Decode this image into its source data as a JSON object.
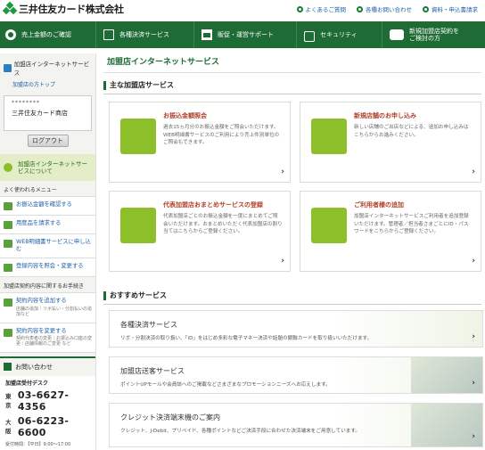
{
  "header": {
    "logo_text": "三井住友カード株式会社",
    "links": [
      "よくあるご質問",
      "各種お問い合わせ",
      "資料・申込書請求"
    ]
  },
  "nav": {
    "items": [
      "売上金額のご確認",
      "各種決済サービス",
      "販促・運営サポート",
      "セキュリティ",
      "新規加盟店契約を\nご検討の方"
    ]
  },
  "sidebar": {
    "title": "加盟店インターネットサービス",
    "sub_link": "加盟店の方トップ",
    "user_id": "********",
    "user_name": "三井住友カード商店",
    "logout_label": "ログアウト",
    "promo_text": "加盟店インターネットサービスについて",
    "menu_heading": "よく使われるメニュー",
    "menu_items": [
      {
        "label": "お振込金額を確認する",
        "note": ""
      },
      {
        "label": "用度品を請求する",
        "note": ""
      },
      {
        "label": "WEB明細書サービスに申し込む",
        "note": ""
      },
      {
        "label": "登録内容を照会・変更する",
        "note": ""
      }
    ],
    "contract_heading": "加盟店契約内容に関するお手続き",
    "contract_items": [
      {
        "label": "契約内容を追加する",
        "note": "店舗の追加｜リボ払い・分割払いの追加など"
      },
      {
        "label": "契約内容を変更する",
        "note": "契約代表者の変更｜お振込み口座の変更｜店舗情報のご変更 など"
      }
    ],
    "contact": {
      "heading": "お問い合わせ",
      "desk": "加盟店受付デスク",
      "tokyo_label": "東京",
      "tokyo_number": "03-6627-4356",
      "osaka_label": "大阪",
      "osaka_number": "06-6223-6600",
      "hours": "受付時間：【平日】9:00〜17:00"
    }
  },
  "main": {
    "page_title": "加盟店インターネットサービス",
    "section_main": "主な加盟店サービス",
    "cards": [
      {
        "title": "お振込金額照会",
        "desc": "過去15ヵ月分のお振込金額をご照会いただけます。WEB明細書サービスのご利用により売上件別単位のご照会もできます。"
      },
      {
        "title": "新規店舗のお申し込み",
        "desc": "新しい店舗のご出店などによる、追加お申し込みはこちらからお進みください。"
      },
      {
        "title": "代表加盟店おまとめサービスの登録",
        "desc": "代表加盟店ごとのお振込金額を一度にまとめてご照会いただけます。おまとめいただく代表加盟店の割り当てはこちらからご登録ください。"
      },
      {
        "title": "ご利用者様の追加",
        "desc": "加盟店インターネットサービスご利用者を追加登録いただけます。管理者／担当者さまごとにID・パスワードをこちらからご登録ください。"
      }
    ],
    "section_rec": "おすすめサービス",
    "recs": [
      {
        "title": "各種決済サービス",
        "desc": "リボ・分割決済の取り扱い、「iD」をはじめ多彩な電子マネー決済や話題の銀聯カードを取り扱いいただけます。"
      },
      {
        "title": "加盟店送客サービス",
        "desc": "ポイントUPモールや会員誌へのご掲載などさまざまなプロモーションニーズへお応えします。"
      },
      {
        "title": "クレジット決済端末機のご案内",
        "desc": "クレジット、J-Debit、プリペイド、各種ポイントなどご決済手段に合わせた決済端末をご用意しています。"
      }
    ]
  }
}
